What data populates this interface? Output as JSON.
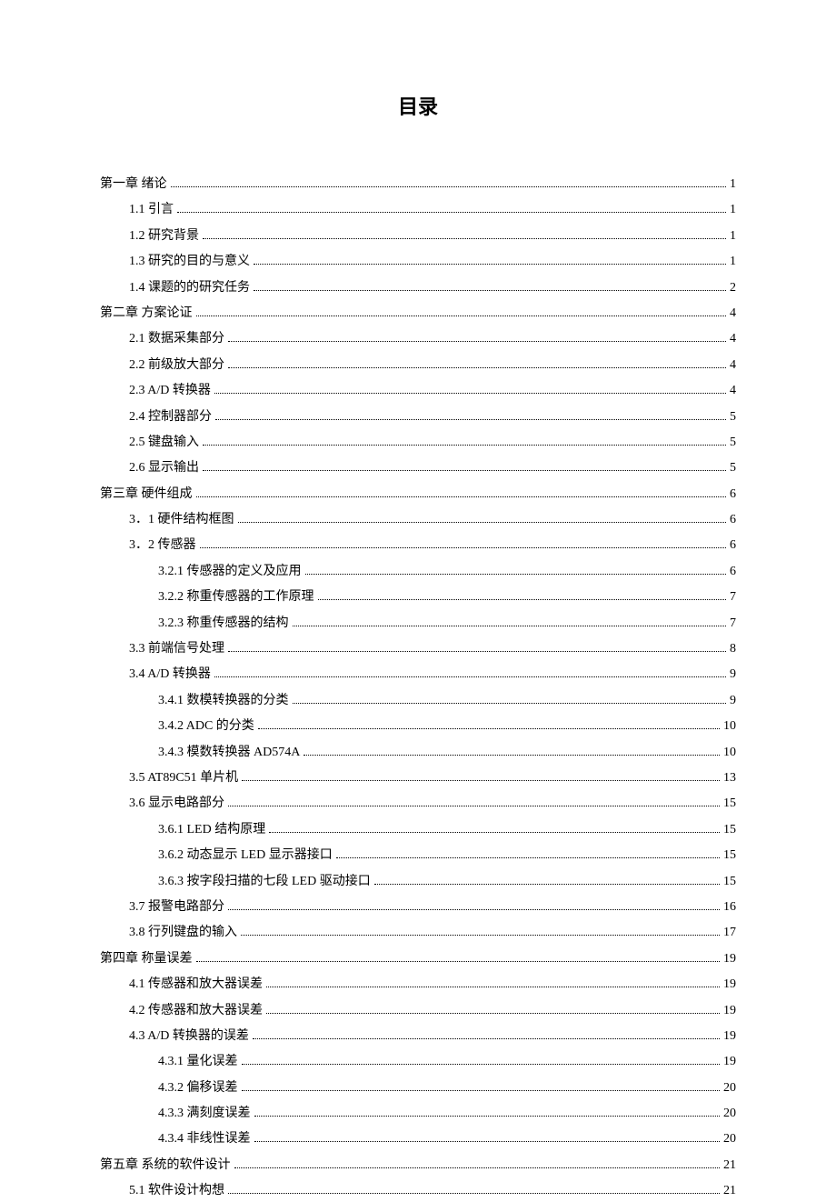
{
  "title": "目录",
  "toc": [
    {
      "label": "第一章 绪论",
      "page": "1",
      "level": 0
    },
    {
      "label": "1.1 引言",
      "page": "1",
      "level": 1
    },
    {
      "label": "1.2 研究背景",
      "page": "1",
      "level": 1
    },
    {
      "label": "1.3 研究的目的与意义",
      "page": "1",
      "level": 1
    },
    {
      "label": "1.4 课题的的研究任务",
      "page": "2",
      "level": 1
    },
    {
      "label": "第二章 方案论证",
      "page": "4",
      "level": 0
    },
    {
      "label": "2.1 数据采集部分",
      "page": "4",
      "level": 1
    },
    {
      "label": "2.2 前级放大部分",
      "page": "4",
      "level": 1
    },
    {
      "label": "2.3 A/D 转换器",
      "page": "4",
      "level": 1
    },
    {
      "label": "2.4 控制器部分",
      "page": "5",
      "level": 1
    },
    {
      "label": "2.5 键盘输入",
      "page": "5",
      "level": 1
    },
    {
      "label": "2.6 显示输出",
      "page": "5",
      "level": 1
    },
    {
      "label": "第三章 硬件组成",
      "page": "6",
      "level": 0
    },
    {
      "label": "3．1 硬件结构框图",
      "page": "6",
      "level": 1
    },
    {
      "label": "3．2 传感器",
      "page": "6",
      "level": 1
    },
    {
      "label": "3.2.1 传感器的定义及应用",
      "page": "6",
      "level": 2
    },
    {
      "label": "3.2.2 称重传感器的工作原理",
      "page": "7",
      "level": 2
    },
    {
      "label": "3.2.3 称重传感器的结构",
      "page": "7",
      "level": 2
    },
    {
      "label": "3.3 前端信号处理",
      "page": "8",
      "level": 1
    },
    {
      "label": "3.4 A/D 转换器",
      "page": "9",
      "level": 1
    },
    {
      "label": "3.4.1 数模转换器的分类",
      "page": "9",
      "level": 2
    },
    {
      "label": "3.4.2 ADC 的分类",
      "page": "10",
      "level": 2
    },
    {
      "label": "3.4.3 模数转换器 AD574A",
      "page": "10",
      "level": 2
    },
    {
      "label": "3.5 AT89C51 单片机",
      "page": "13",
      "level": 1
    },
    {
      "label": "3.6 显示电路部分",
      "page": "15",
      "level": 1
    },
    {
      "label": "3.6.1 LED 结构原理",
      "page": "15",
      "level": 2
    },
    {
      "label": "3.6.2 动态显示 LED 显示器接口",
      "page": "15",
      "level": 2
    },
    {
      "label": "3.6.3 按字段扫描的七段 LED 驱动接口",
      "page": "15",
      "level": 2
    },
    {
      "label": "3.7 报警电路部分",
      "page": "16",
      "level": 1
    },
    {
      "label": "3.8 行列键盘的输入",
      "page": "17",
      "level": 1
    },
    {
      "label": "第四章 称量误差",
      "page": "19",
      "level": 0
    },
    {
      "label": "4.1 传感器和放大器误差",
      "page": "19",
      "level": 1
    },
    {
      "label": "4.2 传感器和放大器误差",
      "page": "19",
      "level": 1
    },
    {
      "label": "4.3 A/D 转换器的误差",
      "page": "19",
      "level": 1
    },
    {
      "label": "4.3.1 量化误差",
      "page": "19",
      "level": 2
    },
    {
      "label": "4.3.2 偏移误差",
      "page": "20",
      "level": 2
    },
    {
      "label": "4.3.3 满刻度误差",
      "page": "20",
      "level": 2
    },
    {
      "label": "4.3.4 非线性误差",
      "page": "20",
      "level": 2
    },
    {
      "label": "第五章 系统的软件设计",
      "page": "21",
      "level": 0
    },
    {
      "label": "5.1 软件设计构想",
      "page": "21",
      "level": 1
    }
  ]
}
